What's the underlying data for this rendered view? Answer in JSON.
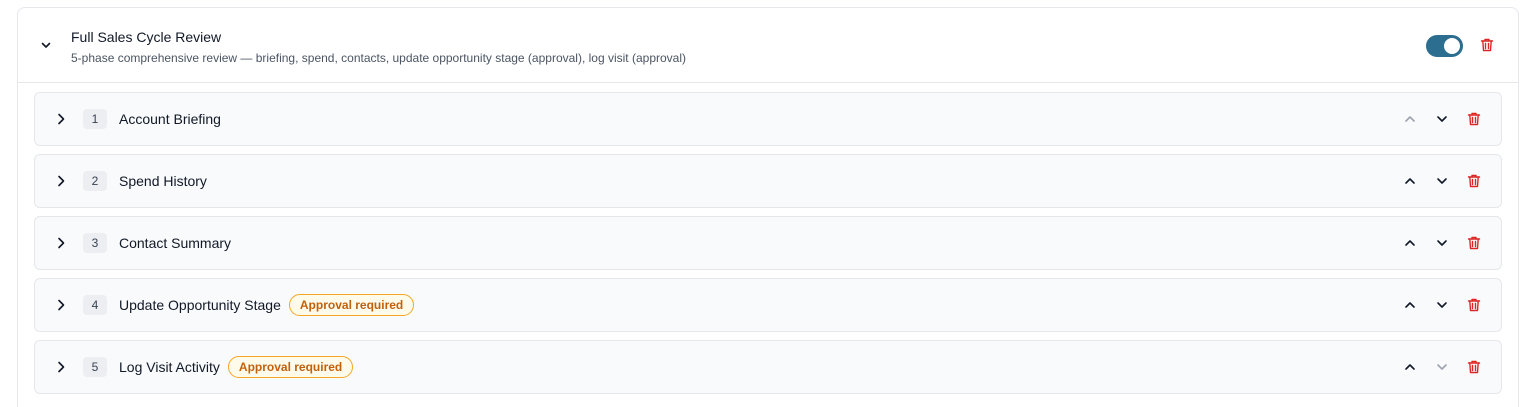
{
  "workflow": {
    "title": "Full Sales Cycle Review",
    "description": "5-phase comprehensive review — briefing, spend, contacts, update opportunity stage (approval), log visit (approval)",
    "enabled": true,
    "expanded": true
  },
  "steps": [
    {
      "number": "1",
      "name": "Account Briefing",
      "badge": "",
      "move_up_enabled": false,
      "move_down_enabled": true
    },
    {
      "number": "2",
      "name": "Spend History",
      "badge": "",
      "move_up_enabled": true,
      "move_down_enabled": true
    },
    {
      "number": "3",
      "name": "Contact Summary",
      "badge": "",
      "move_up_enabled": true,
      "move_down_enabled": true
    },
    {
      "number": "4",
      "name": "Update Opportunity Stage",
      "badge": "Approval required",
      "move_up_enabled": true,
      "move_down_enabled": true
    },
    {
      "number": "5",
      "name": "Log Visit Activity",
      "badge": "Approval required",
      "move_up_enabled": true,
      "move_down_enabled": false
    }
  ],
  "colors": {
    "toggle_on": "#2c6e8f",
    "delete": "#dc2626",
    "badge_border": "#f5a623",
    "badge_text": "#c2610c",
    "icon_active": "#111827",
    "icon_disabled": "#9ca3af"
  },
  "icons": {
    "collapse": "chevron-down-icon",
    "expand": "chevron-right-icon",
    "move_up": "chevron-up-icon",
    "move_down": "chevron-down-icon",
    "delete": "trash-icon"
  }
}
